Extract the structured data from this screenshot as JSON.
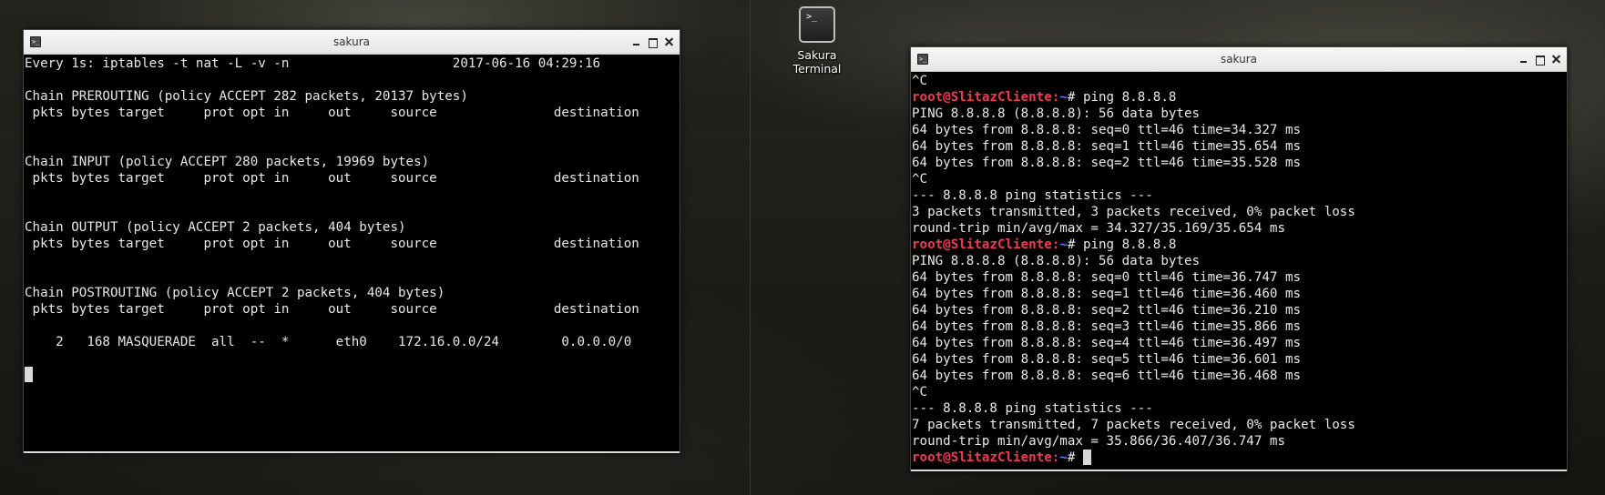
{
  "desktop": {
    "icon": {
      "glyph": ">_",
      "label_line1": "Sakura",
      "label_line2": "Terminal",
      "icon_name": "terminal-icon"
    }
  },
  "window_left": {
    "title": "sakura",
    "lines": [
      "Every 1s: iptables -t nat -L -v -n                     2017-06-16 04:29:16",
      "",
      "Chain PREROUTING (policy ACCEPT 282 packets, 20137 bytes)",
      " pkts bytes target     prot opt in     out     source               destination",
      "",
      "",
      "Chain INPUT (policy ACCEPT 280 packets, 19969 bytes)",
      " pkts bytes target     prot opt in     out     source               destination",
      "",
      "",
      "Chain OUTPUT (policy ACCEPT 2 packets, 404 bytes)",
      " pkts bytes target     prot opt in     out     source               destination",
      "",
      "",
      "Chain POSTROUTING (policy ACCEPT 2 packets, 404 bytes)",
      " pkts bytes target     prot opt in     out     source               destination",
      "",
      "    2   168 MASQUERADE  all  --  *      eth0    172.16.0.0/24        0.0.0.0/0"
    ]
  },
  "window_right": {
    "title": "sakura",
    "prompt": {
      "user_host": "root@SlitazCliente",
      "sep": ":",
      "path": "~",
      "symbol": "# "
    },
    "lines": [
      {
        "type": "out",
        "text": "^C"
      },
      {
        "type": "cmd",
        "text": "ping 8.8.8.8"
      },
      {
        "type": "out",
        "text": "PING 8.8.8.8 (8.8.8.8): 56 data bytes"
      },
      {
        "type": "out",
        "text": "64 bytes from 8.8.8.8: seq=0 ttl=46 time=34.327 ms"
      },
      {
        "type": "out",
        "text": "64 bytes from 8.8.8.8: seq=1 ttl=46 time=35.654 ms"
      },
      {
        "type": "out",
        "text": "64 bytes from 8.8.8.8: seq=2 ttl=46 time=35.528 ms"
      },
      {
        "type": "out",
        "text": "^C"
      },
      {
        "type": "out",
        "text": "--- 8.8.8.8 ping statistics ---"
      },
      {
        "type": "out",
        "text": "3 packets transmitted, 3 packets received, 0% packet loss"
      },
      {
        "type": "out",
        "text": "round-trip min/avg/max = 34.327/35.169/35.654 ms"
      },
      {
        "type": "cmd",
        "text": "ping 8.8.8.8"
      },
      {
        "type": "out",
        "text": "PING 8.8.8.8 (8.8.8.8): 56 data bytes"
      },
      {
        "type": "out",
        "text": "64 bytes from 8.8.8.8: seq=0 ttl=46 time=36.747 ms"
      },
      {
        "type": "out",
        "text": "64 bytes from 8.8.8.8: seq=1 ttl=46 time=36.460 ms"
      },
      {
        "type": "out",
        "text": "64 bytes from 8.8.8.8: seq=2 ttl=46 time=36.210 ms"
      },
      {
        "type": "out",
        "text": "64 bytes from 8.8.8.8: seq=3 ttl=46 time=35.866 ms"
      },
      {
        "type": "out",
        "text": "64 bytes from 8.8.8.8: seq=4 ttl=46 time=36.497 ms"
      },
      {
        "type": "out",
        "text": "64 bytes from 8.8.8.8: seq=5 ttl=46 time=36.601 ms"
      },
      {
        "type": "out",
        "text": "64 bytes from 8.8.8.8: seq=6 ttl=46 time=36.468 ms"
      },
      {
        "type": "out",
        "text": "^C"
      },
      {
        "type": "out",
        "text": "--- 8.8.8.8 ping statistics ---"
      },
      {
        "type": "out",
        "text": "7 packets transmitted, 7 packets received, 0% packet loss"
      },
      {
        "type": "out",
        "text": "round-trip min/avg/max = 35.866/36.407/36.747 ms"
      },
      {
        "type": "cmd",
        "text": ""
      }
    ]
  },
  "colors": {
    "prompt_user": "#ef3b50",
    "prompt_path": "#5a7cff",
    "terminal_bg": "#000000",
    "terminal_fg": "#e8e8e8"
  }
}
